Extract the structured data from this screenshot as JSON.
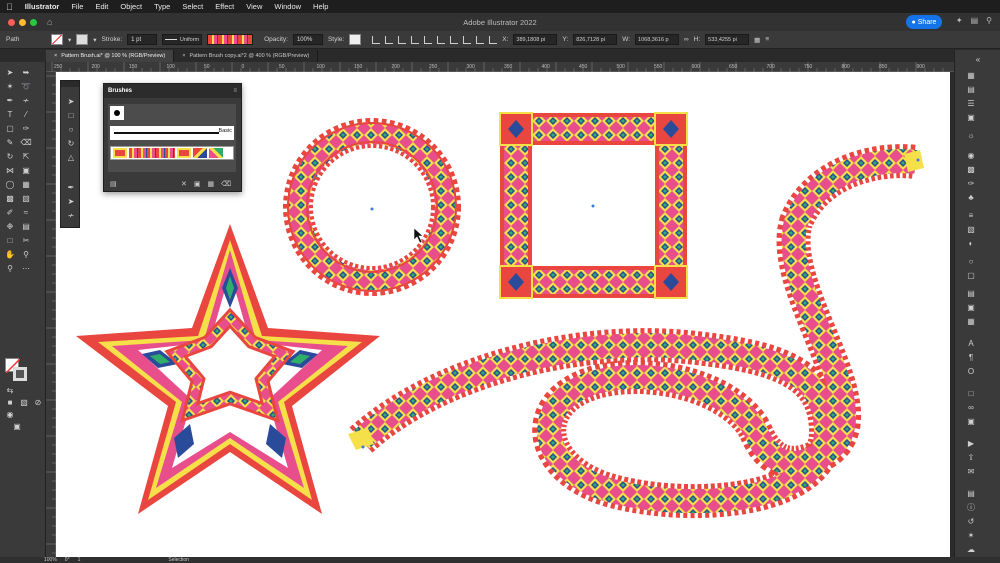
{
  "menubar": {
    "apple": "",
    "app_name": "Illustrator",
    "items": [
      "File",
      "Edit",
      "Object",
      "Type",
      "Select",
      "Effect",
      "View",
      "Window",
      "Help"
    ]
  },
  "titlebar": {
    "title": "Adobe Illustrator 2022",
    "share_label": "Share"
  },
  "controlbar": {
    "selection_type": "Path",
    "stroke_label": "Stroke:",
    "stroke_weight": "1 pt",
    "profile_label": "Uniform",
    "opacity_label": "Opacity:",
    "opacity_value": "100%",
    "style_label": "Style:",
    "x_label": "X:",
    "x_value": "389,1808 pi",
    "y_label": "Y:",
    "y_value": "826,7128 pi",
    "w_label": "W:",
    "w_value": "1068,3616 p",
    "h_label": "H:",
    "h_value": "533,4255 pi"
  },
  "tabs": [
    {
      "label": "Pattern Brush.ai* @ 100 % (RGB/Preview)",
      "active": true
    },
    {
      "label": "Pattern Brush copy.ai*2 @ 400 % (RGB/Preview)",
      "active": false
    }
  ],
  "ruler_ticks": [
    "250",
    "200",
    "150",
    "100",
    "50",
    "0",
    "50",
    "100",
    "150",
    "200",
    "250",
    "300",
    "350",
    "400",
    "450",
    "500",
    "550",
    "600",
    "650",
    "700",
    "750",
    "800",
    "850",
    "900"
  ],
  "brushes_panel": {
    "title": "Brushes",
    "basic_label": "Basic"
  },
  "statusbar": {
    "zoom": "100%",
    "rotation": "0°",
    "artboard": "1",
    "mode": "Selection"
  },
  "colors": {
    "red": "#e8463f",
    "yellow": "#f6e04a",
    "pink": "#e94e8c",
    "blue": "#2a4b9a",
    "green": "#2fae6a"
  }
}
